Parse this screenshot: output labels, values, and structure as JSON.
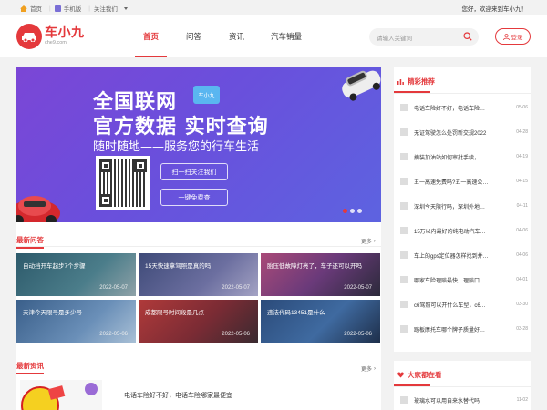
{
  "topbar": {
    "home_label": "首页",
    "mobile_label": "手机版",
    "follow_label": "关注我们",
    "welcome": "您好，欢迎来到车小九！"
  },
  "logo": {
    "name": "车小九",
    "domain": "che9.com"
  },
  "nav": {
    "items": [
      {
        "label": "首页",
        "active": true
      },
      {
        "label": "问答",
        "active": false
      },
      {
        "label": "资讯",
        "active": false
      },
      {
        "label": "汽车销量",
        "active": false
      }
    ]
  },
  "search": {
    "placeholder": "请输入关键词"
  },
  "login_label": "登录",
  "banner": {
    "line1": "全国联网",
    "line2": "官方数据 实时查询",
    "line3": "随时随地——服务您的行车生活",
    "app_badge": "车小九",
    "btn_follow": "扫一扫关注我们",
    "btn_free": "一键免费查"
  },
  "qa_section": {
    "title": "最新问答",
    "more": "更多",
    "cards": [
      {
        "title": "自动挡开车起步7个步骤",
        "date": "2022-05-07"
      },
      {
        "title": "15天快速拿驾照是真的吗",
        "date": "2022-05-07"
      },
      {
        "title": "胎压低故障灯亮了，车子还可以开吗",
        "date": "2022-05-07"
      },
      {
        "title": "天津今天限号是多少号",
        "date": "2022-05-06"
      },
      {
        "title": "成都限号时间段是几点",
        "date": "2022-05-06"
      },
      {
        "title": "违法代码13451是什么",
        "date": "2022-05-06"
      }
    ]
  },
  "news_section": {
    "title": "最新资讯",
    "more": "更多",
    "first_title": "电话车险好不好，电话车险哪家最便宜"
  },
  "recommend": {
    "title": "精彩推荐",
    "items": [
      {
        "title": "电话车险好不好，电话车险…",
        "date": "05-06"
      },
      {
        "title": "无证驾驶怎么处罚新交规2022",
        "date": "04-28"
      },
      {
        "title": "摘装加油站如何审批手续，…",
        "date": "04-19"
      },
      {
        "title": "五一高速免费吗?五一高速公…",
        "date": "04-15"
      },
      {
        "title": "深圳今天限行吗，深圳外地…",
        "date": "04-11"
      },
      {
        "title": "15万以内最好的纯电动汽车…",
        "date": "04-06"
      },
      {
        "title": "车上的gps定位器怎样找到并…",
        "date": "04-06"
      },
      {
        "title": "哪家车险理赔最快，理赔口…",
        "date": "04-01"
      },
      {
        "title": "c6驾照可以开什么车型，c6…",
        "date": "03-30"
      },
      {
        "title": "踏板摩托车哪个牌子质量好…",
        "date": "03-28"
      }
    ]
  },
  "popular": {
    "title": "大家都在看",
    "items": [
      {
        "title": "玻璃水可以用自来水替代吗",
        "date": "11-02"
      }
    ]
  },
  "colors": {
    "brand": "#e4393c",
    "banner_purple": "#6a4fdc"
  }
}
